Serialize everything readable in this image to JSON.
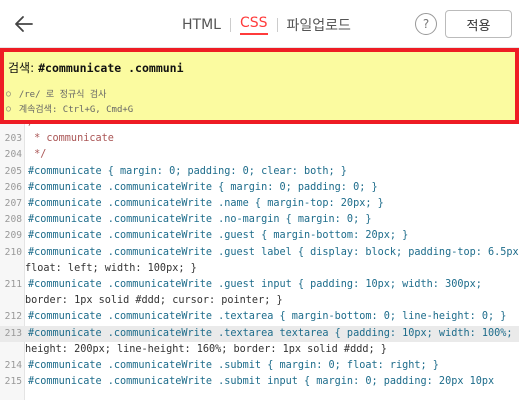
{
  "topbar": {
    "tabs": [
      {
        "label": "HTML",
        "active": false
      },
      {
        "label": "CSS",
        "active": true
      },
      {
        "label": "파일업로드",
        "active": false
      }
    ],
    "help_label": "?",
    "apply_label": "적용"
  },
  "search": {
    "label": "검색:",
    "value": "#communicate .communi",
    "hints": [
      "/re/ 로 정규식 검사",
      "계속검색: Ctrl+G, Cmd+G"
    ]
  },
  "editor": {
    "lines": [
      {
        "n": "",
        "text": "/*"
      },
      {
        "n": "203",
        "text": " * communicate"
      },
      {
        "n": "204",
        "text": " */"
      },
      {
        "n": "205",
        "text": "#communicate { margin: 0; padding: 0; clear: both; }"
      },
      {
        "n": "206",
        "text": "#communicate .communicateWrite { margin: 0; padding: 0; }"
      },
      {
        "n": "207",
        "text": "#communicate .communicateWrite .name { margin-top: 20px; }"
      },
      {
        "n": "208",
        "text": "#communicate .communicateWrite .no-margin { margin: 0; }"
      },
      {
        "n": "209",
        "text": "#communicate .communicateWrite .guest { margin-bottom: 20px; }"
      },
      {
        "n": "210",
        "text": "#communicate .communicateWrite .guest label { display: block; padding-top: 6.5px;"
      },
      {
        "n": "",
        "text": "float: left; width: 100px; }"
      },
      {
        "n": "211",
        "text": "#communicate .communicateWrite .guest input { padding: 10px; width: 300px;"
      },
      {
        "n": "",
        "text": "border: 1px solid #ddd; cursor: pointer; }"
      },
      {
        "n": "212",
        "text": "#communicate .communicateWrite .textarea { margin-bottom: 0; line-height: 0; }"
      },
      {
        "n": "213",
        "text": "#communicate .communicateWrite .textarea textarea { padding: 10px; width: 100%;",
        "highlight": true
      },
      {
        "n": "",
        "text": "height: 200px; line-height: 160%; border: 1px solid #ddd; }"
      },
      {
        "n": "214",
        "text": "#communicate .communicateWrite .submit { margin: 0; float: right; }"
      },
      {
        "n": "215",
        "text": "#communicate .communicateWrite .submit input { margin: 0; padding: 20px 10px"
      }
    ]
  }
}
